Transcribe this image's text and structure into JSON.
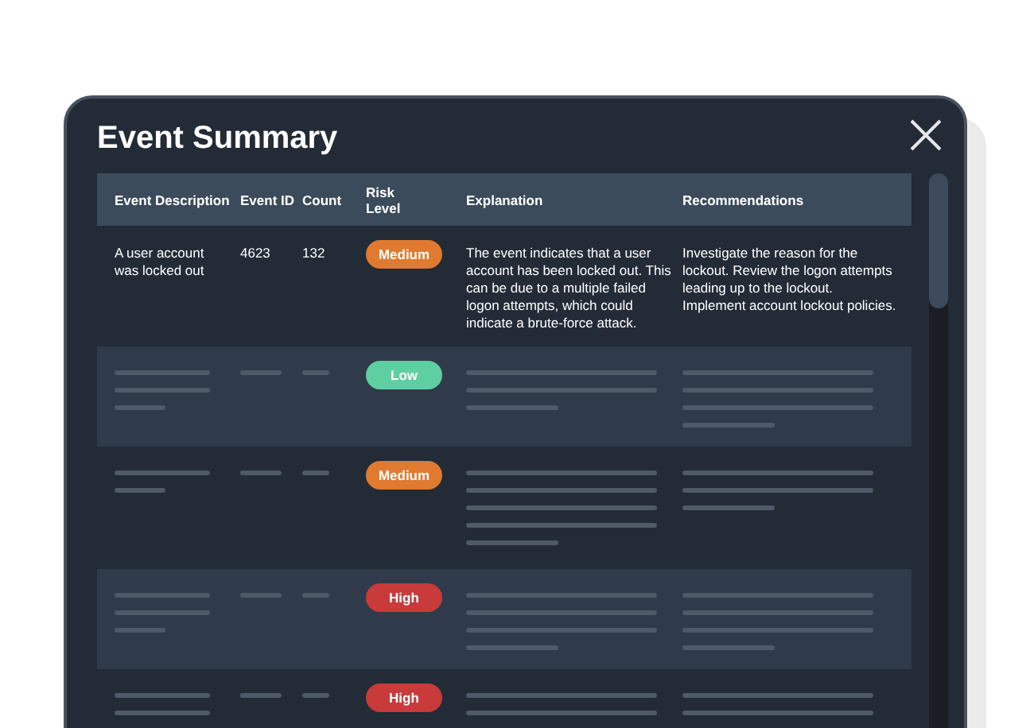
{
  "window": {
    "title": "Event Summary"
  },
  "table": {
    "columns": [
      "Event Description",
      "Event ID",
      "Count",
      "Risk Level",
      "Explanation",
      "Recommendations"
    ],
    "rows": [
      {
        "kind": "text",
        "description": "A user account was locked out",
        "event_id": "4623",
        "count": "132",
        "risk": {
          "label": "Medium",
          "color": "#e07a30"
        },
        "explanation": "The event indicates that a user account has been locked out. This can be due to a multiple failed logon attempts, which could indicate a brute-force attack.",
        "recommendations": "Investigate the reason for the lockout. Review the logon attempts leading up to the lockout. Implement account lockout policies."
      },
      {
        "kind": "skeleton",
        "risk": {
          "label": "Low",
          "color": "#5ecfa0"
        }
      },
      {
        "kind": "skeleton",
        "risk": {
          "label": "Medium",
          "color": "#e07a30"
        }
      },
      {
        "kind": "skeleton",
        "risk": {
          "label": "High",
          "color": "#c93a3a"
        }
      },
      {
        "kind": "skeleton",
        "risk": {
          "label": "High",
          "color": "#c93a3a"
        }
      }
    ]
  }
}
